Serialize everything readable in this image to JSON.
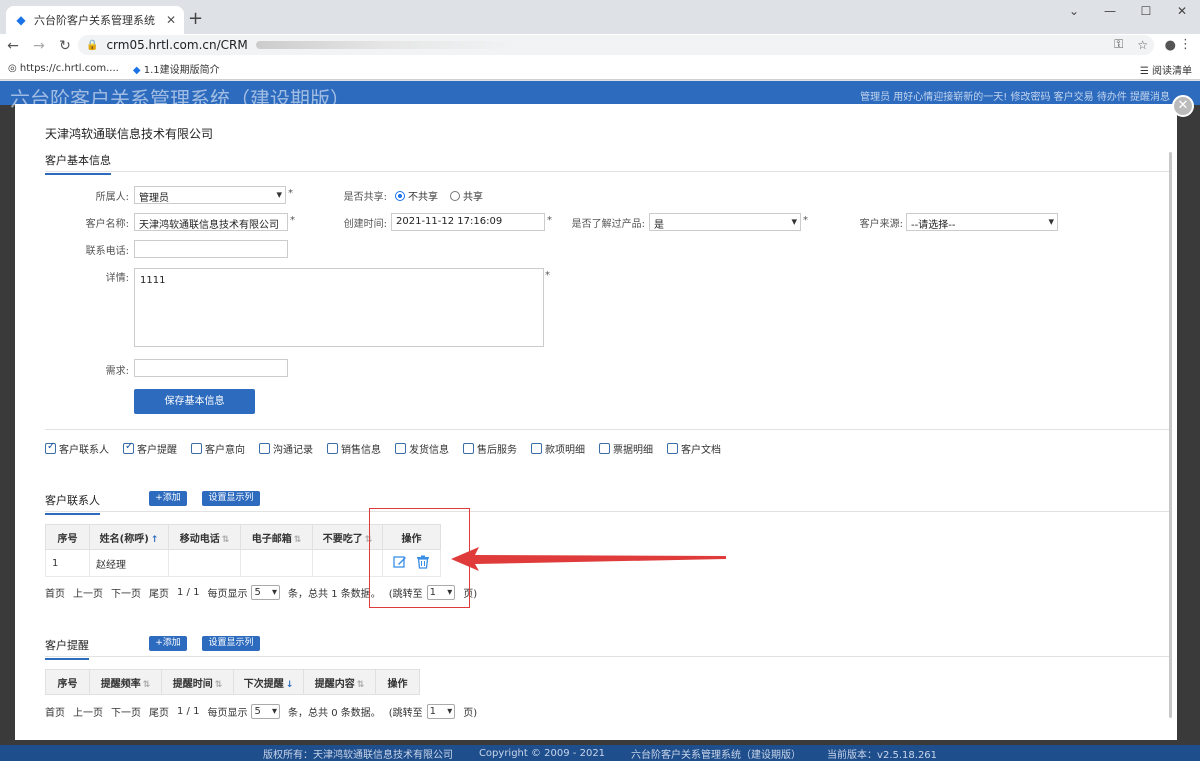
{
  "browser": {
    "tab_title": "六台阶客户关系管理系统（建设期",
    "url": "crm05.hrtl.com.cn/CRM",
    "bookmarks": [
      "https://c.hrtl.com....",
      "1.1建设期版简介"
    ],
    "reading_list": "阅读清单"
  },
  "app": {
    "title": "六台阶客户关系管理系统（建设期版）",
    "nav": "管理员 用好心情迎接崭新的一天!   修改密码   客户交易   待办件   提醒消息",
    "footer": {
      "copyright": "版权所有：天津鸿软通联信息技术有限公司",
      "years": "Copyright © 2009 - 2021",
      "system": "六台阶客户关系管理系统（建设期版）",
      "version": "当前版本：v2.5.18.261"
    }
  },
  "modal": {
    "company": "天津鸿软通联信息技术有限公司",
    "basic_section": "客户基本信息",
    "fields": {
      "owner_label": "所属人:",
      "owner_value": "管理员",
      "shared_label": "是否共享:",
      "shared_options": [
        "不共享",
        "共享"
      ],
      "name_label": "客户名称:",
      "name_value": "天津鸿软通联信息技术有限公司",
      "created_label": "创建时间:",
      "created_value": "2021-11-12 17:16:09",
      "known_label": "是否了解过产品:",
      "known_value": "是",
      "source_label": "客户来源:",
      "source_value": "--请选择--",
      "phone_label": "联系电话:",
      "phone_value": "",
      "detail_label": "详情:",
      "detail_value": "1111",
      "need_label": "需求:",
      "need_value": "",
      "required_mark": "*"
    },
    "save_button": "保存基本信息",
    "modules": [
      {
        "label": "客户联系人",
        "checked": true
      },
      {
        "label": "客户提醒",
        "checked": true
      },
      {
        "label": "客户意向",
        "checked": false
      },
      {
        "label": "沟通记录",
        "checked": false
      },
      {
        "label": "销售信息",
        "checked": false
      },
      {
        "label": "发货信息",
        "checked": false
      },
      {
        "label": "售后服务",
        "checked": false
      },
      {
        "label": "款项明细",
        "checked": false
      },
      {
        "label": "票据明细",
        "checked": false
      },
      {
        "label": "客户文档",
        "checked": false
      }
    ],
    "contacts": {
      "title": "客户联系人",
      "add": "+添加",
      "columns_btn": "设置显示列",
      "headers": [
        "序号",
        "姓名(称呼)",
        "移动电话",
        "电子邮箱",
        "不要吃了",
        "操作"
      ],
      "rows": [
        [
          "1",
          "赵经理",
          "",
          "",
          ""
        ]
      ],
      "pager": {
        "first": "首页",
        "prev": "上一页",
        "next": "下一页",
        "last": "尾页",
        "page": "1 / 1",
        "per_page_label": "每页显示",
        "per_page": "5",
        "summary": "条，总共 1 条数据。",
        "jump": "(跳转至",
        "jump_page": "1",
        "jump_end": "页)"
      }
    },
    "reminders": {
      "title": "客户提醒",
      "add": "+添加",
      "columns_btn": "设置显示列",
      "headers": [
        "序号",
        "提醒频率",
        "提醒时间",
        "下次提醒",
        "提醒内容",
        "操作"
      ],
      "pager": {
        "first": "首页",
        "prev": "上一页",
        "next": "下一页",
        "last": "尾页",
        "page": "1 / 1",
        "per_page_label": "每页显示",
        "per_page": "5",
        "summary": "条，总共 0 条数据。",
        "jump": "(跳转至",
        "jump_page": "1",
        "jump_end": "页)"
      }
    }
  },
  "colors": {
    "brand": "#2d6bbf",
    "annotation": "#e03b3b"
  }
}
